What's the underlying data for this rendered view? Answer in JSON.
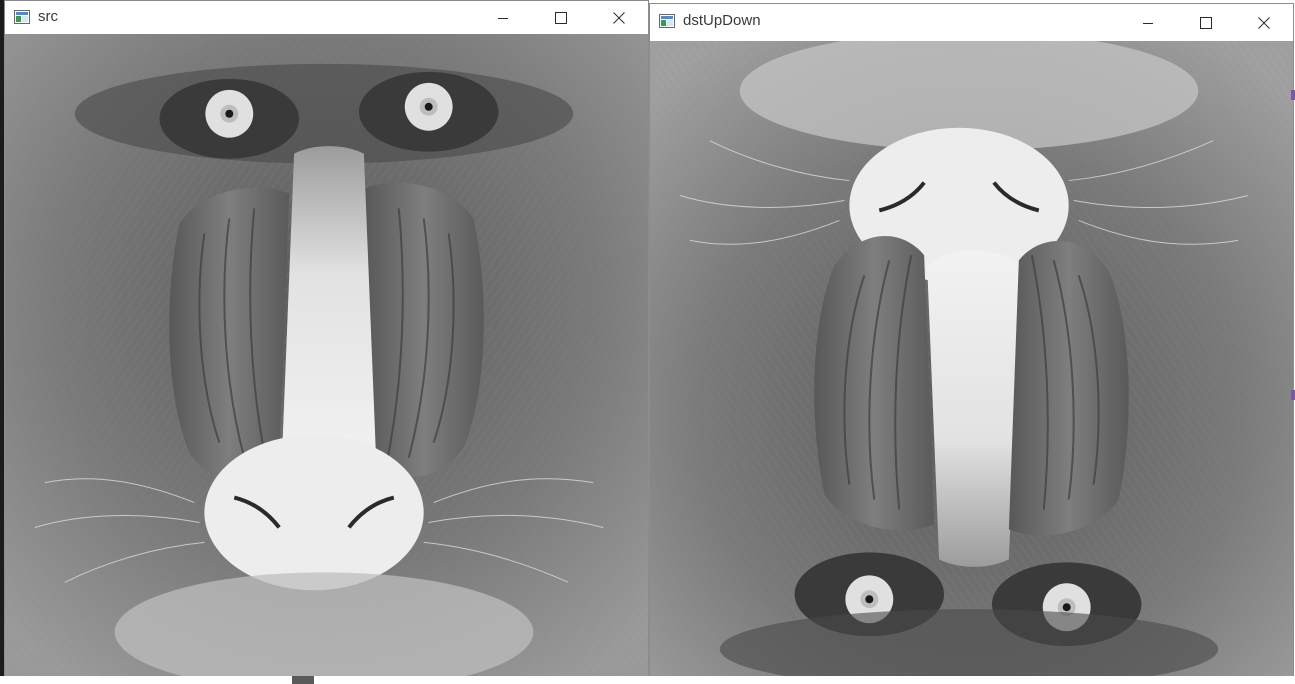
{
  "windows": [
    {
      "title": "src",
      "orientation": "upright",
      "controls": {
        "minimize": "minimize-icon",
        "maximize": "maximize-icon",
        "close": "close-icon"
      }
    },
    {
      "title": "dstUpDown",
      "orientation": "vertically-flipped",
      "controls": {
        "minimize": "minimize-icon",
        "maximize": "maximize-icon",
        "close": "close-icon"
      }
    }
  ],
  "image_subject": "mandrill-face-grayscale",
  "colors": {
    "titlebar_bg": "#ffffff",
    "title_text": "#3a3a3a",
    "window_border": "#8c8c8c",
    "icon_blue": "#4a8bd6",
    "icon_green": "#3a9a4a"
  }
}
